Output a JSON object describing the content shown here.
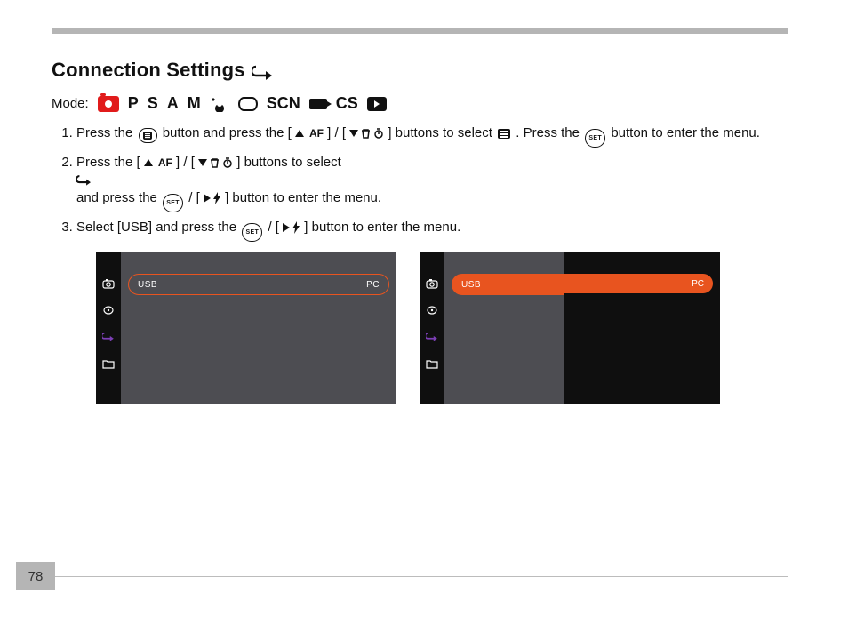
{
  "page_number": "78",
  "heading": "Connection Settings",
  "mode_label": "Mode:",
  "mode_icons": {
    "P": "P",
    "S": "S",
    "A": "A",
    "M": "M",
    "SCN": "SCN",
    "CS": "CS"
  },
  "steps": {
    "s1a": "Press the ",
    "s1b": " button and press the [ ",
    "s1b2": " ] / [ ",
    "s1c": " ] buttons to select ",
    "s1d": ". Press the ",
    "s1e": " button to enter the menu.",
    "s2a": "Press the [ ",
    "s2a2": " ] / [ ",
    "s2b": " ] buttons to select ",
    "s2c": " and press the ",
    "s2d": " / [ ",
    "s2e": " ] button to enter the menu.",
    "s3a": "Select [USB] and press the ",
    "s3b": " / [ ",
    "s3c": " ] button to enter the menu."
  },
  "af_label": "AF",
  "set_label": "SET",
  "screens": {
    "left": {
      "usb": "USB",
      "pc": "PC"
    },
    "right": {
      "usb": "USB",
      "pc": "PC"
    }
  }
}
